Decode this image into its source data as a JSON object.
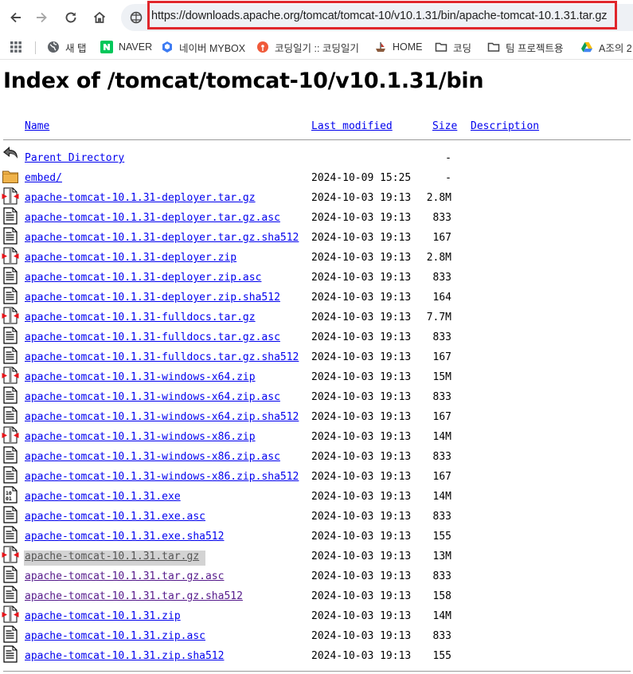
{
  "browser": {
    "url": "https://downloads.apache.org/tomcat/tomcat-10/v10.1.31/bin/apache-tomcat-10.1.31.tar.gz",
    "bookmarks": [
      {
        "label": "새 탭",
        "icon": "globe-icon"
      },
      {
        "label": "NAVER",
        "icon": "naver-icon"
      },
      {
        "label": "네이버 MYBOX",
        "icon": "mybox-icon"
      },
      {
        "label": "코딩일기 :: 코딩일기",
        "icon": "blog-icon"
      },
      {
        "label": "HOME",
        "icon": "ship-icon"
      },
      {
        "label": "코딩",
        "icon": "folder-icon"
      },
      {
        "label": "팀 프로젝트용",
        "icon": "folder-icon"
      },
      {
        "label": "A조의 2",
        "icon": "drive-icon"
      }
    ]
  },
  "page": {
    "title": "Index of /tomcat/tomcat-10/v10.1.31/bin",
    "columns": {
      "name": "Name",
      "modified": "Last modified",
      "size": "Size",
      "description": "Description"
    },
    "rows": [
      {
        "name": "Parent Directory",
        "date": "",
        "size": "-",
        "icon": "back-icon"
      },
      {
        "name": "embed/",
        "date": "2024-10-09 15:25",
        "size": "-",
        "icon": "folder-icon"
      },
      {
        "name": "apache-tomcat-10.1.31-deployer.tar.gz",
        "date": "2024-10-03 19:13",
        "size": "2.8M",
        "icon": "archive-icon"
      },
      {
        "name": "apache-tomcat-10.1.31-deployer.tar.gz.asc",
        "date": "2024-10-03 19:13",
        "size": "833",
        "icon": "text-file-icon"
      },
      {
        "name": "apache-tomcat-10.1.31-deployer.tar.gz.sha512",
        "date": "2024-10-03 19:13",
        "size": "167",
        "icon": "text-file-icon"
      },
      {
        "name": "apache-tomcat-10.1.31-deployer.zip",
        "date": "2024-10-03 19:13",
        "size": "2.8M",
        "icon": "archive-icon"
      },
      {
        "name": "apache-tomcat-10.1.31-deployer.zip.asc",
        "date": "2024-10-03 19:13",
        "size": "833",
        "icon": "text-file-icon"
      },
      {
        "name": "apache-tomcat-10.1.31-deployer.zip.sha512",
        "date": "2024-10-03 19:13",
        "size": "164",
        "icon": "text-file-icon"
      },
      {
        "name": "apache-tomcat-10.1.31-fulldocs.tar.gz",
        "date": "2024-10-03 19:13",
        "size": "7.7M",
        "icon": "archive-icon"
      },
      {
        "name": "apache-tomcat-10.1.31-fulldocs.tar.gz.asc",
        "date": "2024-10-03 19:13",
        "size": "833",
        "icon": "text-file-icon"
      },
      {
        "name": "apache-tomcat-10.1.31-fulldocs.tar.gz.sha512",
        "date": "2024-10-03 19:13",
        "size": "167",
        "icon": "text-file-icon"
      },
      {
        "name": "apache-tomcat-10.1.31-windows-x64.zip",
        "date": "2024-10-03 19:13",
        "size": "15M",
        "icon": "archive-icon"
      },
      {
        "name": "apache-tomcat-10.1.31-windows-x64.zip.asc",
        "date": "2024-10-03 19:13",
        "size": "833",
        "icon": "text-file-icon"
      },
      {
        "name": "apache-tomcat-10.1.31-windows-x64.zip.sha512",
        "date": "2024-10-03 19:13",
        "size": "167",
        "icon": "text-file-icon"
      },
      {
        "name": "apache-tomcat-10.1.31-windows-x86.zip",
        "date": "2024-10-03 19:13",
        "size": "14M",
        "icon": "archive-icon"
      },
      {
        "name": "apache-tomcat-10.1.31-windows-x86.zip.asc",
        "date": "2024-10-03 19:13",
        "size": "833",
        "icon": "text-file-icon"
      },
      {
        "name": "apache-tomcat-10.1.31-windows-x86.zip.sha512",
        "date": "2024-10-03 19:13",
        "size": "167",
        "icon": "text-file-icon"
      },
      {
        "name": "apache-tomcat-10.1.31.exe",
        "date": "2024-10-03 19:13",
        "size": "14M",
        "icon": "binary-icon"
      },
      {
        "name": "apache-tomcat-10.1.31.exe.asc",
        "date": "2024-10-03 19:13",
        "size": "833",
        "icon": "text-file-icon"
      },
      {
        "name": "apache-tomcat-10.1.31.exe.sha512",
        "date": "2024-10-03 19:13",
        "size": "155",
        "icon": "text-file-icon"
      },
      {
        "name": "apache-tomcat-10.1.31.tar.gz",
        "date": "2024-10-03 19:13",
        "size": "13M",
        "icon": "archive-icon",
        "highlighted": true
      },
      {
        "name": "apache-tomcat-10.1.31.tar.gz.asc",
        "date": "2024-10-03 19:13",
        "size": "833",
        "icon": "text-file-icon",
        "visited": true
      },
      {
        "name": "apache-tomcat-10.1.31.tar.gz.sha512",
        "date": "2024-10-03 19:13",
        "size": "158",
        "icon": "text-file-icon",
        "visited": true
      },
      {
        "name": "apache-tomcat-10.1.31.zip",
        "date": "2024-10-03 19:13",
        "size": "14M",
        "icon": "archive-icon"
      },
      {
        "name": "apache-tomcat-10.1.31.zip.asc",
        "date": "2024-10-03 19:13",
        "size": "833",
        "icon": "text-file-icon"
      },
      {
        "name": "apache-tomcat-10.1.31.zip.sha512",
        "date": "2024-10-03 19:13",
        "size": "155",
        "icon": "text-file-icon"
      }
    ]
  },
  "colors": {
    "link": "#0000ee",
    "visited": "#551a8b",
    "url_highlight": "#e0262b"
  }
}
